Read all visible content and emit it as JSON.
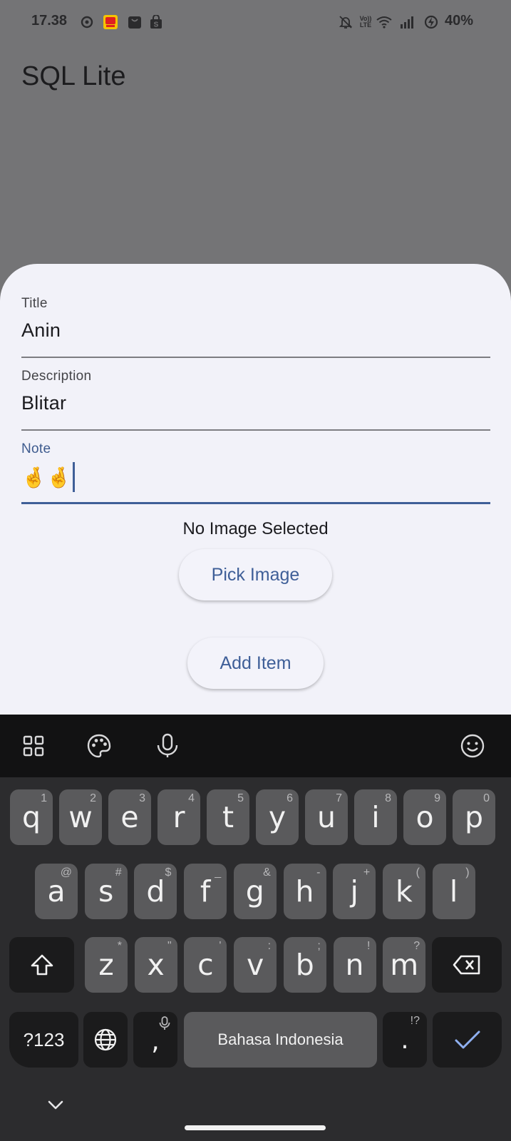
{
  "status_bar": {
    "time": "17.38",
    "battery": "40%",
    "icons": [
      "notification-circle-icon",
      "app-notification-icon",
      "shopping-bag-icon",
      "shop-icon",
      "mute-bell-icon",
      "volte-icon",
      "wifi-icon",
      "signal-icon",
      "battery-charging-icon"
    ],
    "volte_line1": "Vo))",
    "volte_line2": "LTE"
  },
  "app_bar": {
    "title": "SQL Lite"
  },
  "form": {
    "title_label": "Title",
    "title_value": "Anin",
    "description_label": "Description",
    "description_value": "Blitar",
    "note_label": "Note",
    "note_value": "🤞🤞",
    "image_status": "No Image Selected",
    "pick_image_label": "Pick Image",
    "add_item_label": "Add Item"
  },
  "colors": {
    "scrim": "#747476",
    "sheet": "#f2f2f9",
    "accent": "#3f5f98",
    "keyboard_bg": "#2c2c2e",
    "key": "#5a5a5c"
  },
  "keyboard": {
    "toolbar_icons": [
      "apps-grid-icon",
      "palette-icon",
      "microphone-icon",
      "emoji-icon"
    ],
    "row1": [
      {
        "k": "q",
        "h": "1"
      },
      {
        "k": "w",
        "h": "2"
      },
      {
        "k": "e",
        "h": "3"
      },
      {
        "k": "r",
        "h": "4"
      },
      {
        "k": "t",
        "h": "5"
      },
      {
        "k": "y",
        "h": "6"
      },
      {
        "k": "u",
        "h": "7"
      },
      {
        "k": "i",
        "h": "8"
      },
      {
        "k": "o",
        "h": "9"
      },
      {
        "k": "p",
        "h": "0"
      }
    ],
    "row2": [
      {
        "k": "a",
        "h": "@"
      },
      {
        "k": "s",
        "h": "#"
      },
      {
        "k": "d",
        "h": "$"
      },
      {
        "k": "f",
        "h": "_"
      },
      {
        "k": "g",
        "h": "&"
      },
      {
        "k": "h",
        "h": "-"
      },
      {
        "k": "j",
        "h": "+"
      },
      {
        "k": "k",
        "h": "("
      },
      {
        "k": "l",
        "h": ")"
      }
    ],
    "row3": [
      {
        "k": "z",
        "h": "*"
      },
      {
        "k": "x",
        "h": "\""
      },
      {
        "k": "c",
        "h": "'"
      },
      {
        "k": "v",
        "h": ":"
      },
      {
        "k": "b",
        "h": ";"
      },
      {
        "k": "n",
        "h": "!"
      },
      {
        "k": "m",
        "h": "?"
      }
    ],
    "symbols_label": "?123",
    "comma": ",",
    "space_label": "Bahasa Indonesia",
    "period": ".",
    "period_hint": "!?"
  }
}
